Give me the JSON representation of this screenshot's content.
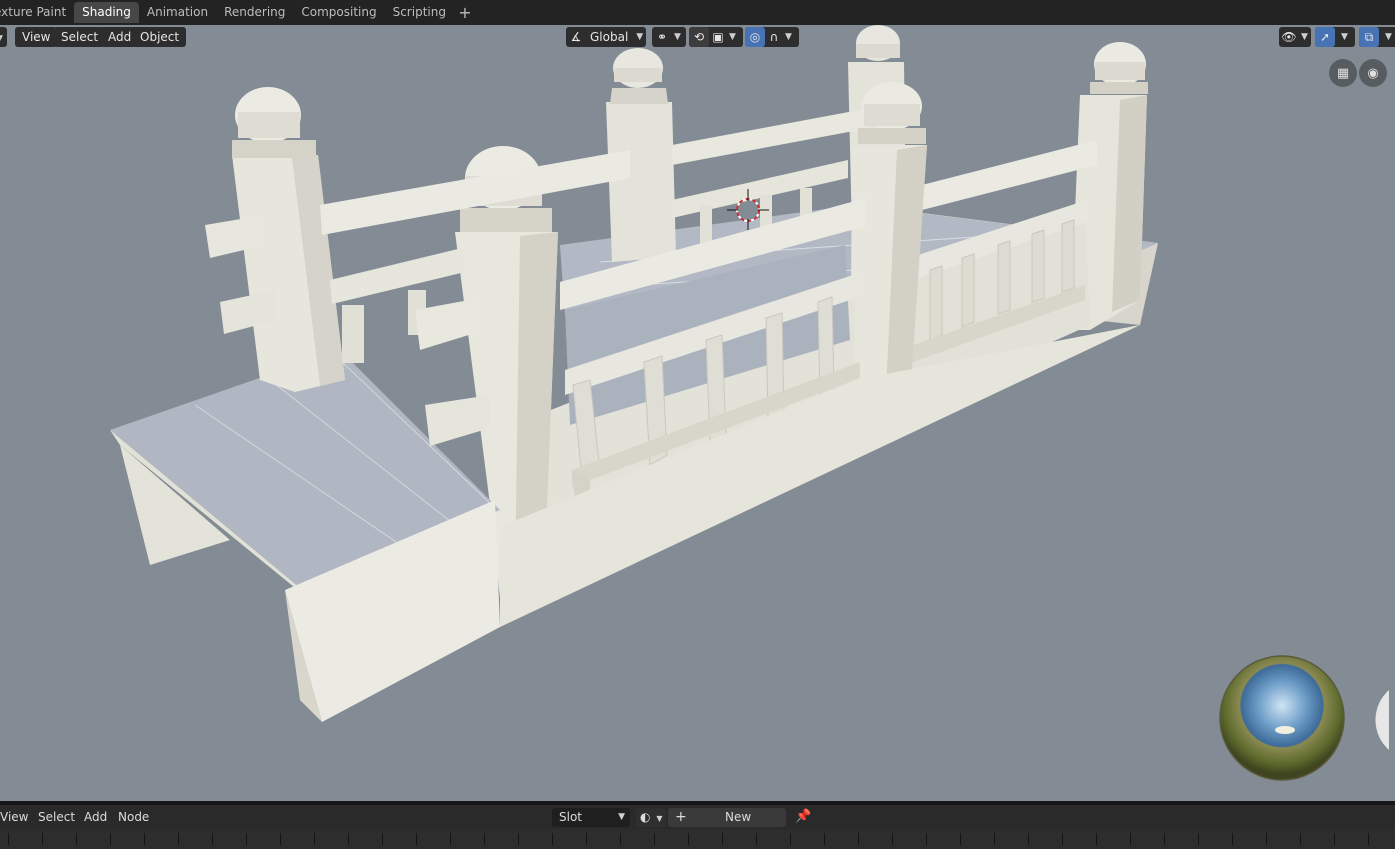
{
  "workspace_tabs": [
    {
      "label": "exture Paint",
      "active": false
    },
    {
      "label": "Shading",
      "active": true
    },
    {
      "label": "Animation",
      "active": false
    },
    {
      "label": "Rendering",
      "active": false
    },
    {
      "label": "Compositing",
      "active": false
    },
    {
      "label": "Scripting",
      "active": false
    }
  ],
  "viewport_header": {
    "menus": [
      "View",
      "Select",
      "Add",
      "Object"
    ],
    "transform_orientation": "Global",
    "icons": [
      "transform-orientation-icon",
      "pivot-point-icon",
      "snap-icon",
      "snap-target-icon",
      "proportional-editing-icon",
      "falloff-icon",
      "visibility-icon",
      "gizmo-icon",
      "overlay-icon"
    ]
  },
  "navigation_icons": [
    "grid-icon",
    "camera-icon"
  ],
  "node_editor_header": {
    "menus": [
      "View",
      "Select",
      "Add",
      "Node"
    ],
    "slot_label": "Slot",
    "new_button": "New",
    "icons": [
      "material-browse-icon",
      "plus-icon",
      "pin-icon"
    ]
  },
  "colors": {
    "viewport_bg": "#838c94",
    "model_light": "#e9e8df",
    "model_mid": "#d9d7cd",
    "model_shadow": "#c5c3b8",
    "deck_top": "#b2b9c4",
    "active_tab": "#474747",
    "accent": "#4772b3"
  }
}
